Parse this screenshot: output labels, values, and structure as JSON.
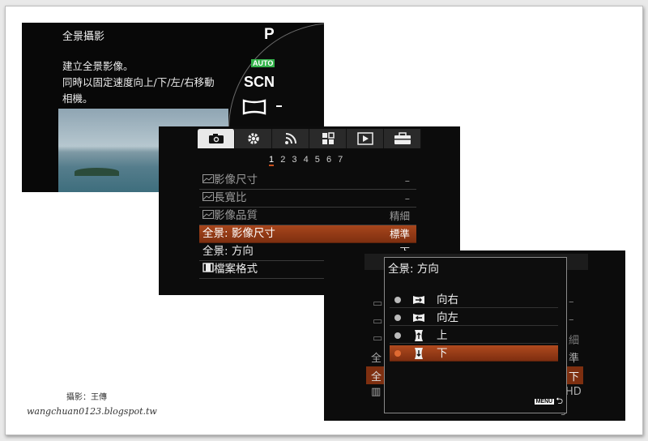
{
  "watermark": {
    "line1": "攝影：王傳",
    "line2": "wangchuan0123.blogspot.tw"
  },
  "screen1": {
    "title": "全景攝影",
    "desc_line1": "建立全景影像。",
    "desc_line2": "同時以固定速度向上/下/左/右移動",
    "desc_line3": "相機。",
    "dial": {
      "mode_p": "P",
      "mode_auto": "AUTO",
      "mode_scn": "SCN"
    }
  },
  "screen2": {
    "tabs": [
      "camera-icon",
      "gear-icon",
      "wireless-icon",
      "custom-grid-icon",
      "playback-icon",
      "toolbox-icon"
    ],
    "active_tab": 0,
    "pages": [
      "1",
      "2",
      "3",
      "4",
      "5",
      "6",
      "7"
    ],
    "current_page": "1",
    "items": [
      {
        "label": "影像尺寸",
        "value": "–",
        "dim": true,
        "icon": true
      },
      {
        "label": "長寬比",
        "value": "–",
        "dim": true,
        "icon": true
      },
      {
        "label": "影像品質",
        "value": "精細",
        "dim": true,
        "icon": true
      },
      {
        "label": "全景: 影像尺寸",
        "value": "標準",
        "dim": false,
        "selected": true
      },
      {
        "label": "全景: 方向",
        "value": "下",
        "dim": false
      },
      {
        "label": "檔案格式",
        "value": "",
        "dim": false,
        "film": true
      }
    ]
  },
  "screen3": {
    "dialog_title": "全景: 方向",
    "options": [
      {
        "label": "向右",
        "icon": "pan-right-icon"
      },
      {
        "label": "向左",
        "icon": "pan-left-icon"
      },
      {
        "label": "上",
        "icon": "pan-up-icon"
      },
      {
        "label": "下",
        "icon": "pan-down-icon",
        "selected": true
      }
    ],
    "bg_values": [
      "–",
      "–",
      "細",
      "準",
      "下",
      "HD"
    ],
    "bg_labels": [
      "全",
      "全"
    ],
    "menu_button": "MENU"
  },
  "colors": {
    "accent": "#a8461c",
    "auto_badge": "#33b24a"
  }
}
